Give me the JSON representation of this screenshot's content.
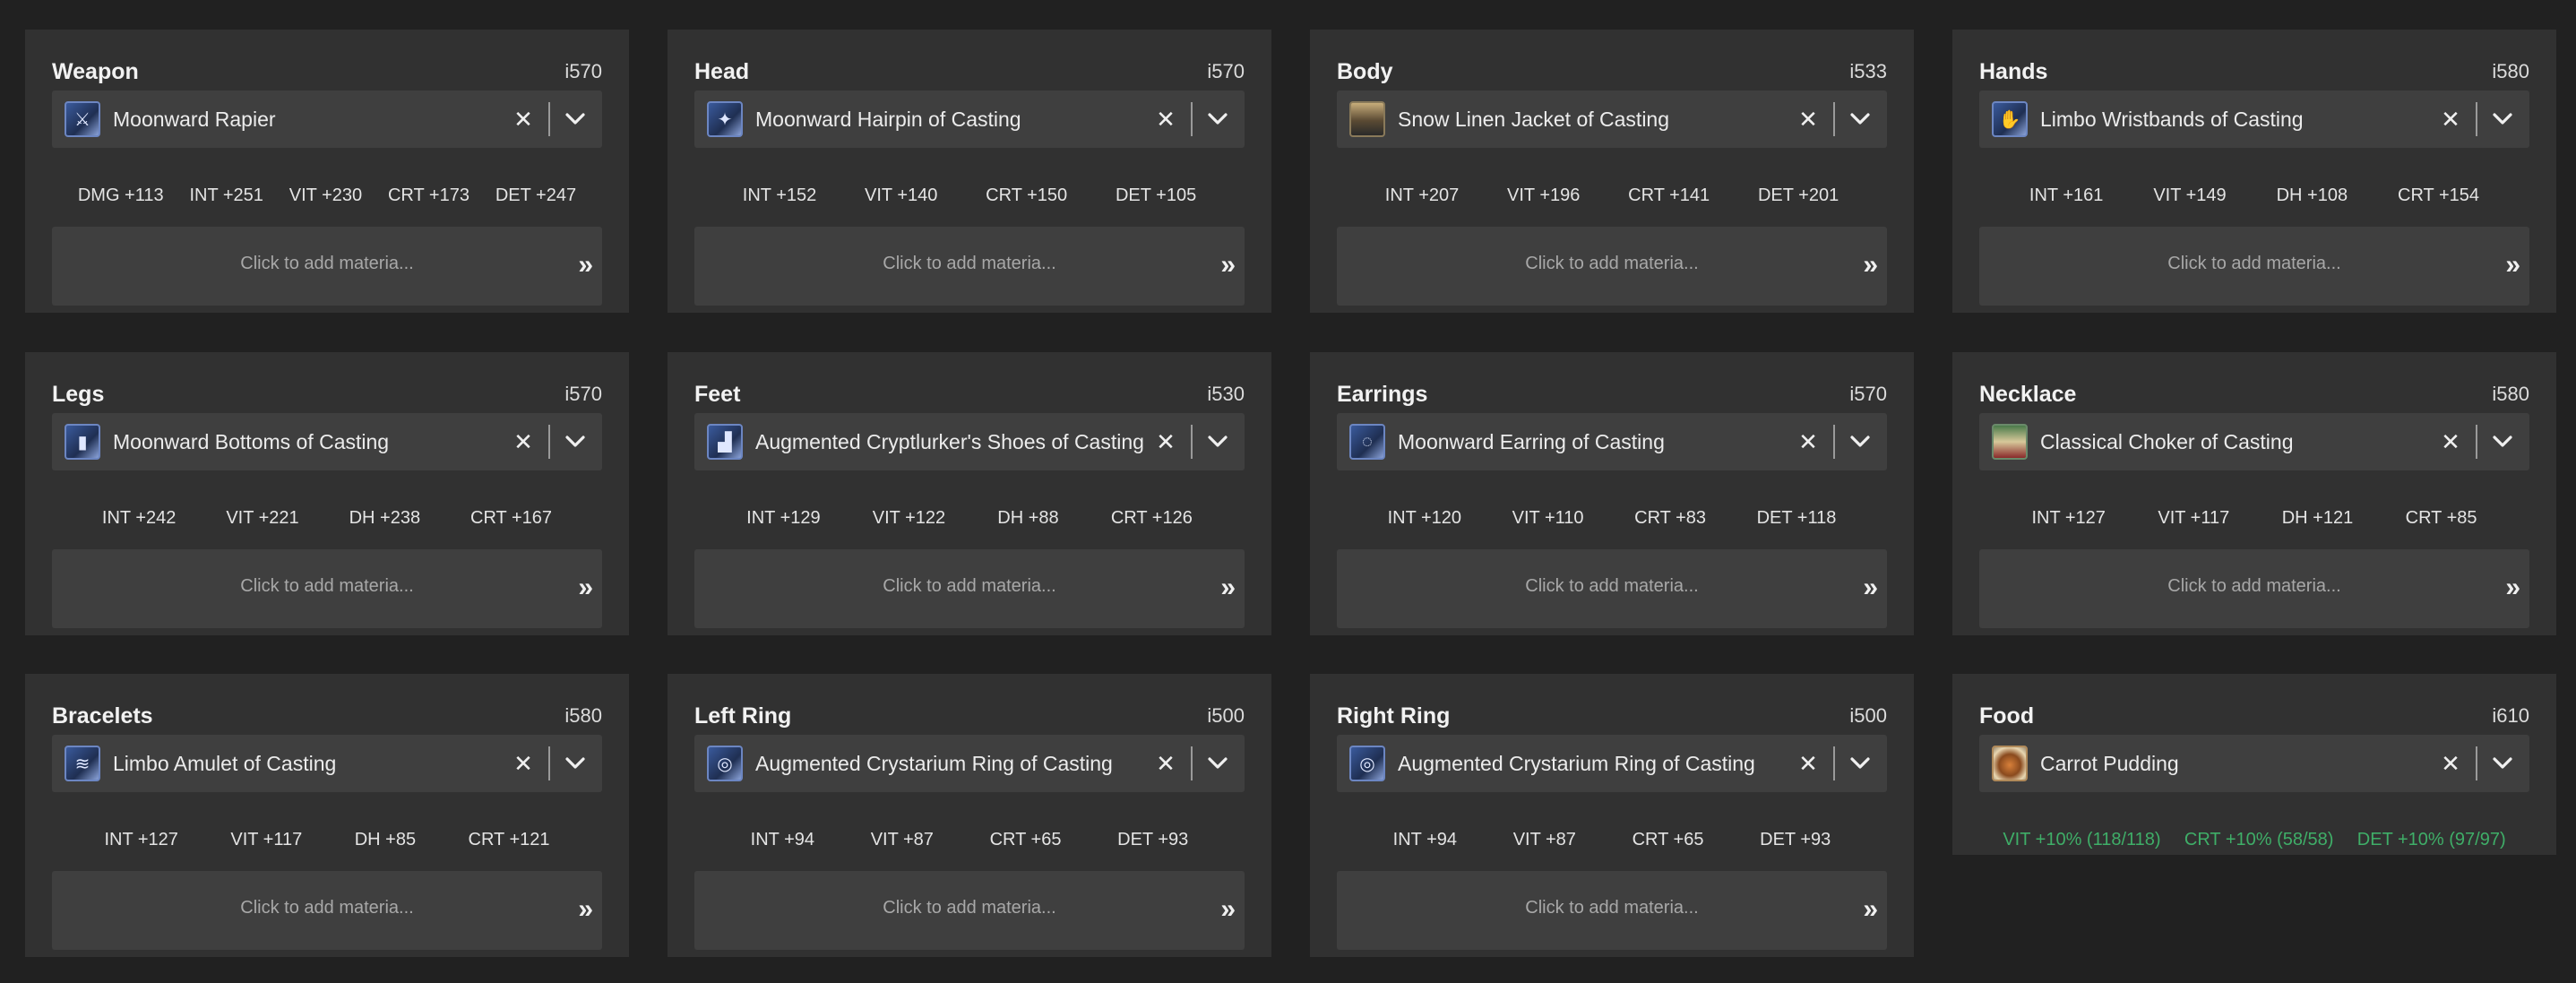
{
  "materia_placeholder": "Click to add materia...",
  "materia_arrow": "»",
  "clear_glyph": "✕",
  "colors": {
    "background": "#212121",
    "card": "#313131",
    "field": "#3f3f3f",
    "food_text": "#3fae68"
  },
  "slots": [
    {
      "title": "Weapon",
      "ilvl": "i570",
      "item": "Moonward Rapier",
      "icon": "rapier-icon",
      "stats": [
        "DMG +113",
        "INT +251",
        "VIT +230",
        "CRT +173",
        "DET +247"
      ]
    },
    {
      "title": "Head",
      "ilvl": "i570",
      "item": "Moonward Hairpin of Casting",
      "icon": "hairpin-icon",
      "stats": [
        "INT +152",
        "VIT +140",
        "CRT +150",
        "DET +105"
      ]
    },
    {
      "title": "Body",
      "ilvl": "i533",
      "item": "Snow Linen Jacket of Casting",
      "icon": "jacket-icon",
      "stats": [
        "INT +207",
        "VIT +196",
        "CRT +141",
        "DET +201"
      ]
    },
    {
      "title": "Hands",
      "ilvl": "i580",
      "item": "Limbo Wristbands of Casting",
      "icon": "wristbands-icon",
      "stats": [
        "INT +161",
        "VIT +149",
        "DH +108",
        "CRT +154"
      ]
    },
    {
      "title": "Legs",
      "ilvl": "i570",
      "item": "Moonward Bottoms of Casting",
      "icon": "bottoms-icon",
      "stats": [
        "INT +242",
        "VIT +221",
        "DH +238",
        "CRT +167"
      ]
    },
    {
      "title": "Feet",
      "ilvl": "i530",
      "item": "Augmented Cryptlurker's Shoes of Casting",
      "icon": "shoes-icon",
      "stats": [
        "INT +129",
        "VIT +122",
        "DH +88",
        "CRT +126"
      ]
    },
    {
      "title": "Earrings",
      "ilvl": "i570",
      "item": "Moonward Earring of Casting",
      "icon": "earring-icon",
      "stats": [
        "INT +120",
        "VIT +110",
        "CRT +83",
        "DET +118"
      ]
    },
    {
      "title": "Necklace",
      "ilvl": "i580",
      "item": "Classical Choker of Casting",
      "icon": "choker-icon",
      "stats": [
        "INT +127",
        "VIT +117",
        "DH +121",
        "CRT +85"
      ]
    },
    {
      "title": "Bracelets",
      "ilvl": "i580",
      "item": "Limbo Amulet of Casting",
      "icon": "amulet-icon",
      "stats": [
        "INT +127",
        "VIT +117",
        "DH +85",
        "CRT +121"
      ]
    },
    {
      "title": "Left Ring",
      "ilvl": "i500",
      "item": "Augmented Crystarium Ring of Casting",
      "icon": "ring-icon",
      "stats": [
        "INT +94",
        "VIT +87",
        "CRT +65",
        "DET +93"
      ]
    },
    {
      "title": "Right Ring",
      "ilvl": "i500",
      "item": "Augmented Crystarium Ring of Casting",
      "icon": "ring-icon",
      "stats": [
        "INT +94",
        "VIT +87",
        "CRT +65",
        "DET +93"
      ]
    }
  ],
  "food": {
    "title": "Food",
    "ilvl": "i610",
    "item": "Carrot Pudding",
    "icon": "pudding-icon",
    "stats": [
      "VIT +10% (118/118)",
      "CRT +10% (58/58)",
      "DET +10% (97/97)"
    ]
  }
}
